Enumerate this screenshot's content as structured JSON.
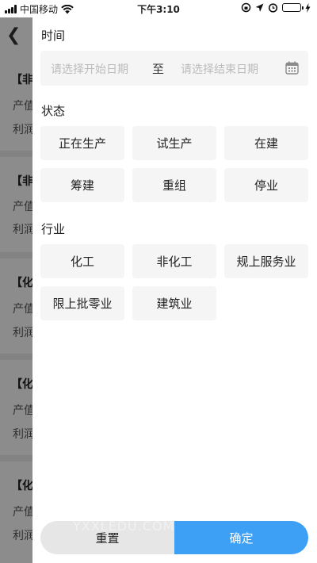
{
  "status_bar": {
    "carrier": "中国移动",
    "time": "下午3:10"
  },
  "background_list": {
    "cards": [
      {
        "title": "【非",
        "line1": "产值",
        "line2": "利润"
      },
      {
        "title": "【非",
        "line1": "产值",
        "line2": "利润"
      },
      {
        "title": "【化",
        "line1": "产值",
        "line2": "利润"
      },
      {
        "title": "【化",
        "line1": "产值",
        "line2": "利润"
      },
      {
        "title": "【化",
        "line1": "产值",
        "line2": "利润"
      }
    ]
  },
  "filter": {
    "time_section": {
      "title": "时间",
      "start_placeholder": "请选择开始日期",
      "separator": "至",
      "end_placeholder": "请选择结束日期"
    },
    "status_section": {
      "title": "状态",
      "options": [
        "正在生产",
        "试生产",
        "在建",
        "筹建",
        "重组",
        "停业"
      ]
    },
    "industry_section": {
      "title": "行业",
      "options": [
        "化工",
        "非化工",
        "规上服务业",
        "限上批零业",
        "建筑业"
      ]
    },
    "reset_label": "重置",
    "confirm_label": "确定"
  },
  "watermark": "YXXLEDU.COM",
  "colors": {
    "accent": "#3ea0f5",
    "chip_bg": "#f5f5f5",
    "battery": "#4cd964"
  }
}
